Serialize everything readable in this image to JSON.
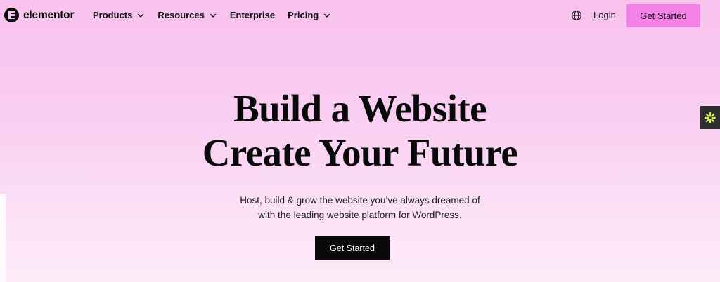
{
  "header": {
    "logo_text": "elementor",
    "menu": [
      {
        "label": "Products",
        "has_dropdown": true
      },
      {
        "label": "Resources",
        "has_dropdown": true
      },
      {
        "label": "Enterprise",
        "has_dropdown": false
      },
      {
        "label": "Pricing",
        "has_dropdown": true
      }
    ],
    "language_icon": "globe-icon",
    "login_label": "Login",
    "cta_label": "Get Started"
  },
  "hero": {
    "title_line1": "Build a Website",
    "title_line2": "Create Your Future",
    "subtitle_line1": "Host, build & grow the website you’ve always dreamed of",
    "subtitle_line2": "with the leading website platform for WordPress.",
    "cta_label": "Get Started"
  },
  "side_widget": {
    "icon": "asterisk-icon"
  },
  "colors": {
    "background_top": "#f8c2ee",
    "background_bottom": "#fcecf8",
    "header_cta": "#f481e5",
    "hero_cta": "#0a0a0a",
    "side_widget_bg": "#2e2e2e",
    "side_widget_icon": "#d7f04b"
  }
}
